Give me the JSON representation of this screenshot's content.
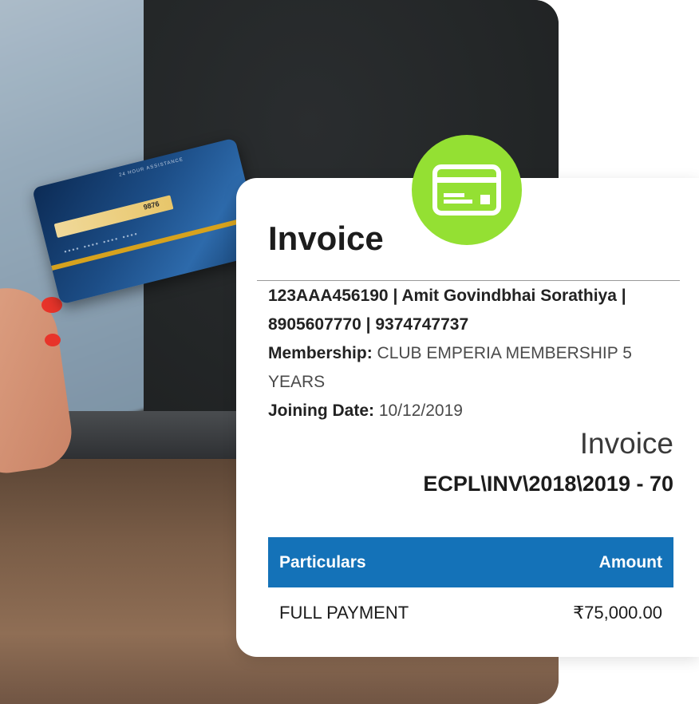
{
  "photo": {
    "card_assist_text": "24 HOUR ASSISTANCE",
    "card_signature_code": "9876",
    "card_digits": "•••• •••• •••• ••••"
  },
  "invoice": {
    "title": "Invoice",
    "customer_line1": "123AAA456190 | Amit Govindbhai Sorathiya |",
    "customer_line2": "8905607770 | 9374747737",
    "membership_label": "Membership:",
    "membership_value": "CLUB EMPERIA MEMBERSHIP 5 YEARS",
    "joining_label": "Joining Date:",
    "joining_value": "10/12/2019",
    "right_heading": "Invoice",
    "invoice_number": "ECPL\\INV\\2018\\2019 - 70",
    "table": {
      "headers": [
        "Particulars",
        "Amount"
      ],
      "rows": [
        [
          "FULL PAYMENT",
          "₹75,000.00"
        ]
      ]
    }
  },
  "badge": {
    "icon": "credit-card-icon",
    "color": "#94e033"
  },
  "colors": {
    "table_header": "#1472b8",
    "badge": "#94e033"
  }
}
